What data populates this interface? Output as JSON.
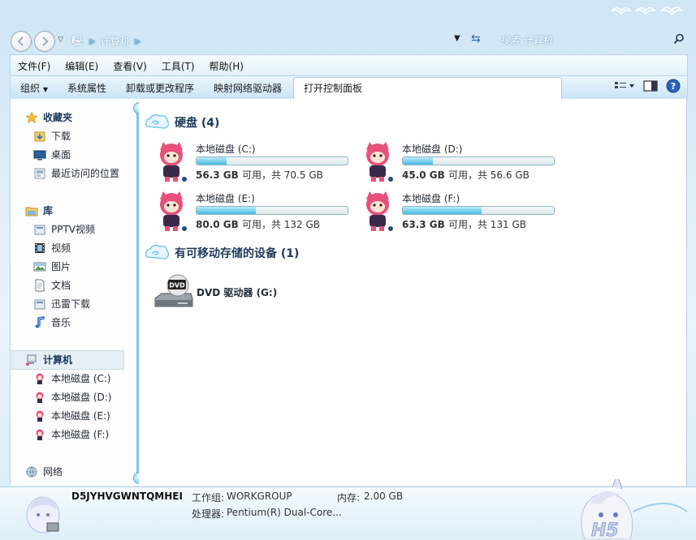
{
  "address": {
    "path": [
      "计算机"
    ],
    "search_placeholder": "搜索 计算机"
  },
  "menu": [
    "文件(F)",
    "编辑(E)",
    "查看(V)",
    "工具(T)",
    "帮助(H)"
  ],
  "toolbar": {
    "organize": "组织",
    "items": [
      "系统属性",
      "卸载或更改程序",
      "映射网络驱动器",
      "打开控制面板"
    ]
  },
  "sidebar": {
    "favorites": {
      "title": "收藏夹",
      "items": [
        "下载",
        "桌面",
        "最近访问的位置"
      ]
    },
    "libraries": {
      "title": "库",
      "items": [
        "PPTV视频",
        "视频",
        "图片",
        "文档",
        "迅雷下载",
        "音乐"
      ]
    },
    "computer": {
      "title": "计算机",
      "items": [
        "本地磁盘 (C:)",
        "本地磁盘 (D:)",
        "本地磁盘 (E:)",
        "本地磁盘 (F:)"
      ]
    },
    "network": {
      "title": "网络"
    }
  },
  "hard_disks": {
    "title": "硬盘 (4)",
    "drives": [
      {
        "name": "本地磁盘 (C:)",
        "free": "56.3 GB",
        "rest": "可用，共 70.5 GB",
        "used_fraction": 0.2
      },
      {
        "name": "本地磁盘 (D:)",
        "free": "45.0 GB",
        "rest": "可用，共 56.6 GB",
        "used_fraction": 0.2
      },
      {
        "name": "本地磁盘 (E:)",
        "free": "80.0 GB",
        "rest": "可用，共 132 GB",
        "used_fraction": 0.39
      },
      {
        "name": "本地磁盘 (F:)",
        "free": "63.3 GB",
        "rest": "可用，共 131 GB",
        "used_fraction": 0.52
      }
    ]
  },
  "removable": {
    "title": "有可移动存储的设备 (1)",
    "dvd": {
      "name": "DVD 驱动器 (G:)",
      "label": "DVD"
    }
  },
  "details": {
    "computer_name": "D5JYHVGWNTQMHEI",
    "workgroup_label": "工作组:",
    "workgroup": "WORKGROUP",
    "memory_label": "内存:",
    "memory": "2.00 GB",
    "processor_label": "处理器:",
    "processor": "Pentium(R) Dual-Core..."
  },
  "colors": {
    "accent": "#7bc7ee",
    "drive_fill": "#49b9e2",
    "fox": "#e8507a"
  }
}
